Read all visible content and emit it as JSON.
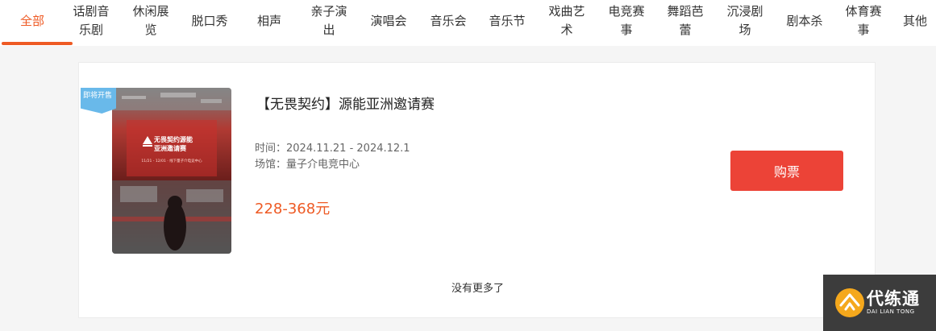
{
  "tabs": [
    {
      "label": "全部"
    },
    {
      "label": "话剧音乐剧"
    },
    {
      "label": "休闲展览"
    },
    {
      "label": "脱口秀"
    },
    {
      "label": "相声"
    },
    {
      "label": "亲子演出"
    },
    {
      "label": "演唱会"
    },
    {
      "label": "音乐会"
    },
    {
      "label": "音乐节"
    },
    {
      "label": "戏曲艺术"
    },
    {
      "label": "电竞赛事"
    },
    {
      "label": "舞蹈芭蕾"
    },
    {
      "label": "沉浸剧场"
    },
    {
      "label": "剧本杀"
    },
    {
      "label": "体育赛事"
    },
    {
      "label": "其他"
    }
  ],
  "active_tab": "全部",
  "event": {
    "ribbon": "即将开售",
    "title": "【无畏契约】源能亚洲邀请赛",
    "time_label": "时间：",
    "time": "2024.11.21 - 2024.12.1",
    "venue_label": "场馆：",
    "venue": "量子介电竞中心",
    "price": "228-368元",
    "buy_label": "购票",
    "poster": {
      "title_line1": "无畏契约源能",
      "title_line2": "亚洲邀请赛",
      "date_line": "11/21 - 12/01 · 线下量子介电竞中心"
    }
  },
  "footer": {
    "no_more": "没有更多了"
  },
  "watermark": {
    "text": "代练通",
    "sub": "DAI LIAN TONG"
  },
  "colors": {
    "accent": "#ee5a24",
    "buy_button": "#ec4337",
    "ribbon": "#69b9ea"
  }
}
